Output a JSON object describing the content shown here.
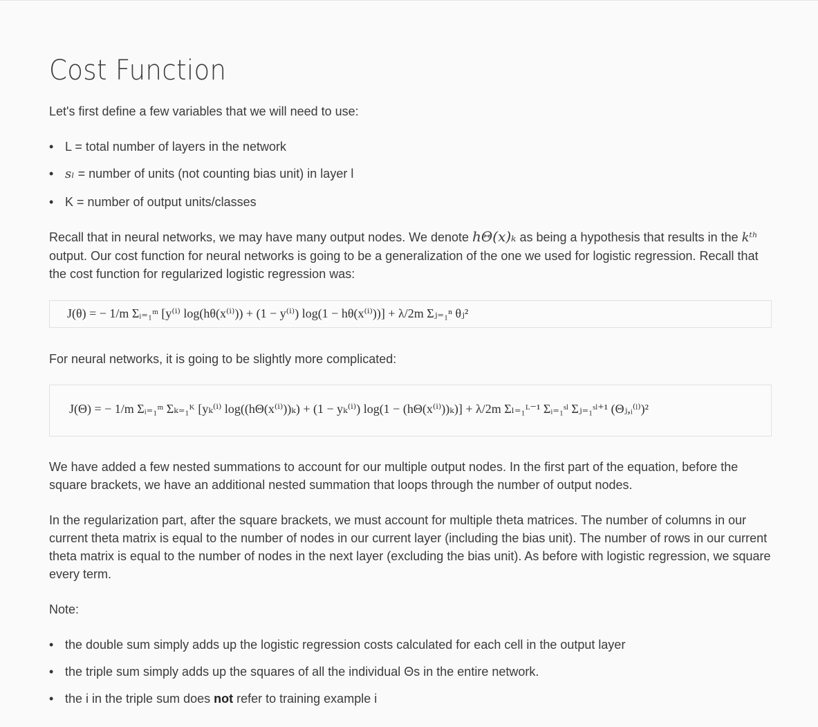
{
  "title": "Cost Function",
  "intro": "Let's first define a few variables that we will need to use:",
  "variables": [
    {
      "prefix": "",
      "text": "L = total number of layers in the network"
    },
    {
      "prefix": "sₗ",
      "text": " = number of units (not counting bias unit) in layer l"
    },
    {
      "prefix": "",
      "text": "K = number of output units/classes"
    }
  ],
  "recall_paragraph": {
    "part1": "Recall that in neural networks, we may have many output nodes. We denote ",
    "math1": "hΘ(x)ₖ",
    "part2": " as being a hypothesis that results in the ",
    "math2": "kᵗʰ",
    "part3": " output. Our cost function for neural networks is going to be a generalization of the one we used for logistic regression. Recall that the cost function for regularized logistic regression was:"
  },
  "formula_logistic": "J(θ) = − 1/m Σᵢ₌₁ᵐ [y⁽ⁱ⁾ log(hθ(x⁽ⁱ⁾)) + (1 − y⁽ⁱ⁾) log(1 − hθ(x⁽ⁱ⁾))] + λ/2m Σⱼ₌₁ⁿ θⱼ²",
  "nn_intro": "For neural networks, it is going to be slightly more complicated:",
  "formula_nn": "J(Θ) = − 1/m Σᵢ₌₁ᵐ Σₖ₌₁ᴷ [yₖ⁽ⁱ⁾ log((hΘ(x⁽ⁱ⁾))ₖ) + (1 − yₖ⁽ⁱ⁾) log(1 − (hΘ(x⁽ⁱ⁾))ₖ)] + λ/2m Σₗ₌₁ᴸ⁻¹ Σᵢ₌₁ˢˡ Σⱼ₌₁ˢˡ⁺¹ (Θⱼ,ᵢ⁽ˡ⁾)²",
  "para_nested": "We have added a few nested summations to account for our multiple output nodes. In the first part of the equation, before the square brackets, we have an additional nested summation that loops through the number of output nodes.",
  "para_regularization": "In the regularization part, after the square brackets, we must account for multiple theta matrices. The number of columns in our current theta matrix is equal to the number of nodes in our current layer (including the bias unit). The number of rows in our current theta matrix is equal to the number of nodes in the next layer (excluding the bias unit). As before with logistic regression, we square every term.",
  "note_label": "Note:",
  "notes": [
    {
      "text": "the double sum simply adds up the logistic regression costs calculated for each cell in the output layer"
    },
    {
      "text": "the triple sum simply adds up the squares of all the individual Θs in the entire network."
    },
    {
      "pre": "the i in the triple sum does ",
      "bold": "not",
      "post": " refer to training example i"
    }
  ]
}
